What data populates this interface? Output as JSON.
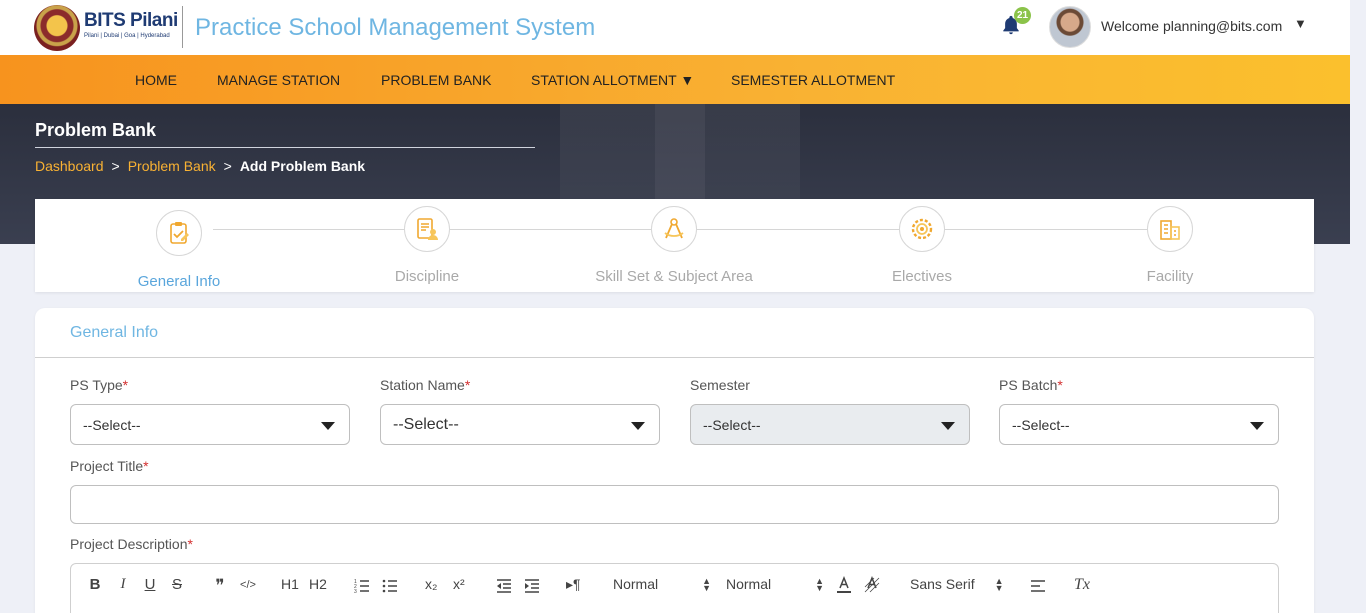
{
  "header": {
    "logo_title": "BITS Pilani",
    "logo_subtitle": "Pilani | Dubai | Goa | Hyderabad",
    "app_title": "Practice School Management System",
    "notification_count": "21",
    "welcome_text": "Welcome planning@bits.com",
    "caret": "▼"
  },
  "nav": {
    "items": [
      "HOME",
      "MANAGE STATION",
      "PROBLEM BANK",
      "STATION ALLOTMENT ▼",
      "SEMESTER ALLOTMENT"
    ]
  },
  "hero": {
    "heading": "Problem Bank",
    "breadcrumb": {
      "items": [
        "Dashboard",
        "Problem Bank"
      ],
      "current": "Add Problem Bank",
      "separator": ">"
    }
  },
  "stepper": {
    "steps": [
      {
        "label": "General Info",
        "icon": "clipboard-check-icon",
        "active": true
      },
      {
        "label": "Discipline",
        "icon": "document-person-icon",
        "active": false
      },
      {
        "label": "Skill Set & Subject Area",
        "icon": "compass-icon",
        "active": false
      },
      {
        "label": "Electives",
        "icon": "gear-icon",
        "active": false
      },
      {
        "label": "Facility",
        "icon": "building-icon",
        "active": false
      }
    ]
  },
  "form": {
    "title": "General Info",
    "ps_type": {
      "label": "PS Type",
      "required_mark": "*",
      "value": "--Select--"
    },
    "station_name": {
      "label": "Station Name",
      "required_mark": "*",
      "value": "--Select--"
    },
    "semester": {
      "label": "Semester",
      "value": "--Select--"
    },
    "ps_batch": {
      "label": "PS Batch",
      "required_mark": "*",
      "value": "--Select--"
    },
    "project_title": {
      "label": "Project Title",
      "required_mark": "*",
      "value": ""
    },
    "project_description": {
      "label": "Project Description",
      "required_mark": "*"
    }
  },
  "editor_toolbar": {
    "bold": "B",
    "italic": "I",
    "underline": "U",
    "strike": "S",
    "blockquote": "❞",
    "code": "</>",
    "h1": "H1",
    "h2": "H2",
    "subscript": "x₂",
    "superscript": "x²",
    "rtl": "▸¶",
    "size_select": "Normal",
    "header_select": "Normal",
    "font_select": "Sans Serif",
    "clean": "Tx"
  },
  "colors": {
    "accent_blue": "#6fb6e2",
    "nav_orange": "#f7931e",
    "nav_yellow": "#fbc02d",
    "breadcrumb_link": "#f9b233",
    "hero_bg": "#2b2f3d",
    "badge_green": "#8bc34a",
    "required_red": "#d32f2f"
  }
}
